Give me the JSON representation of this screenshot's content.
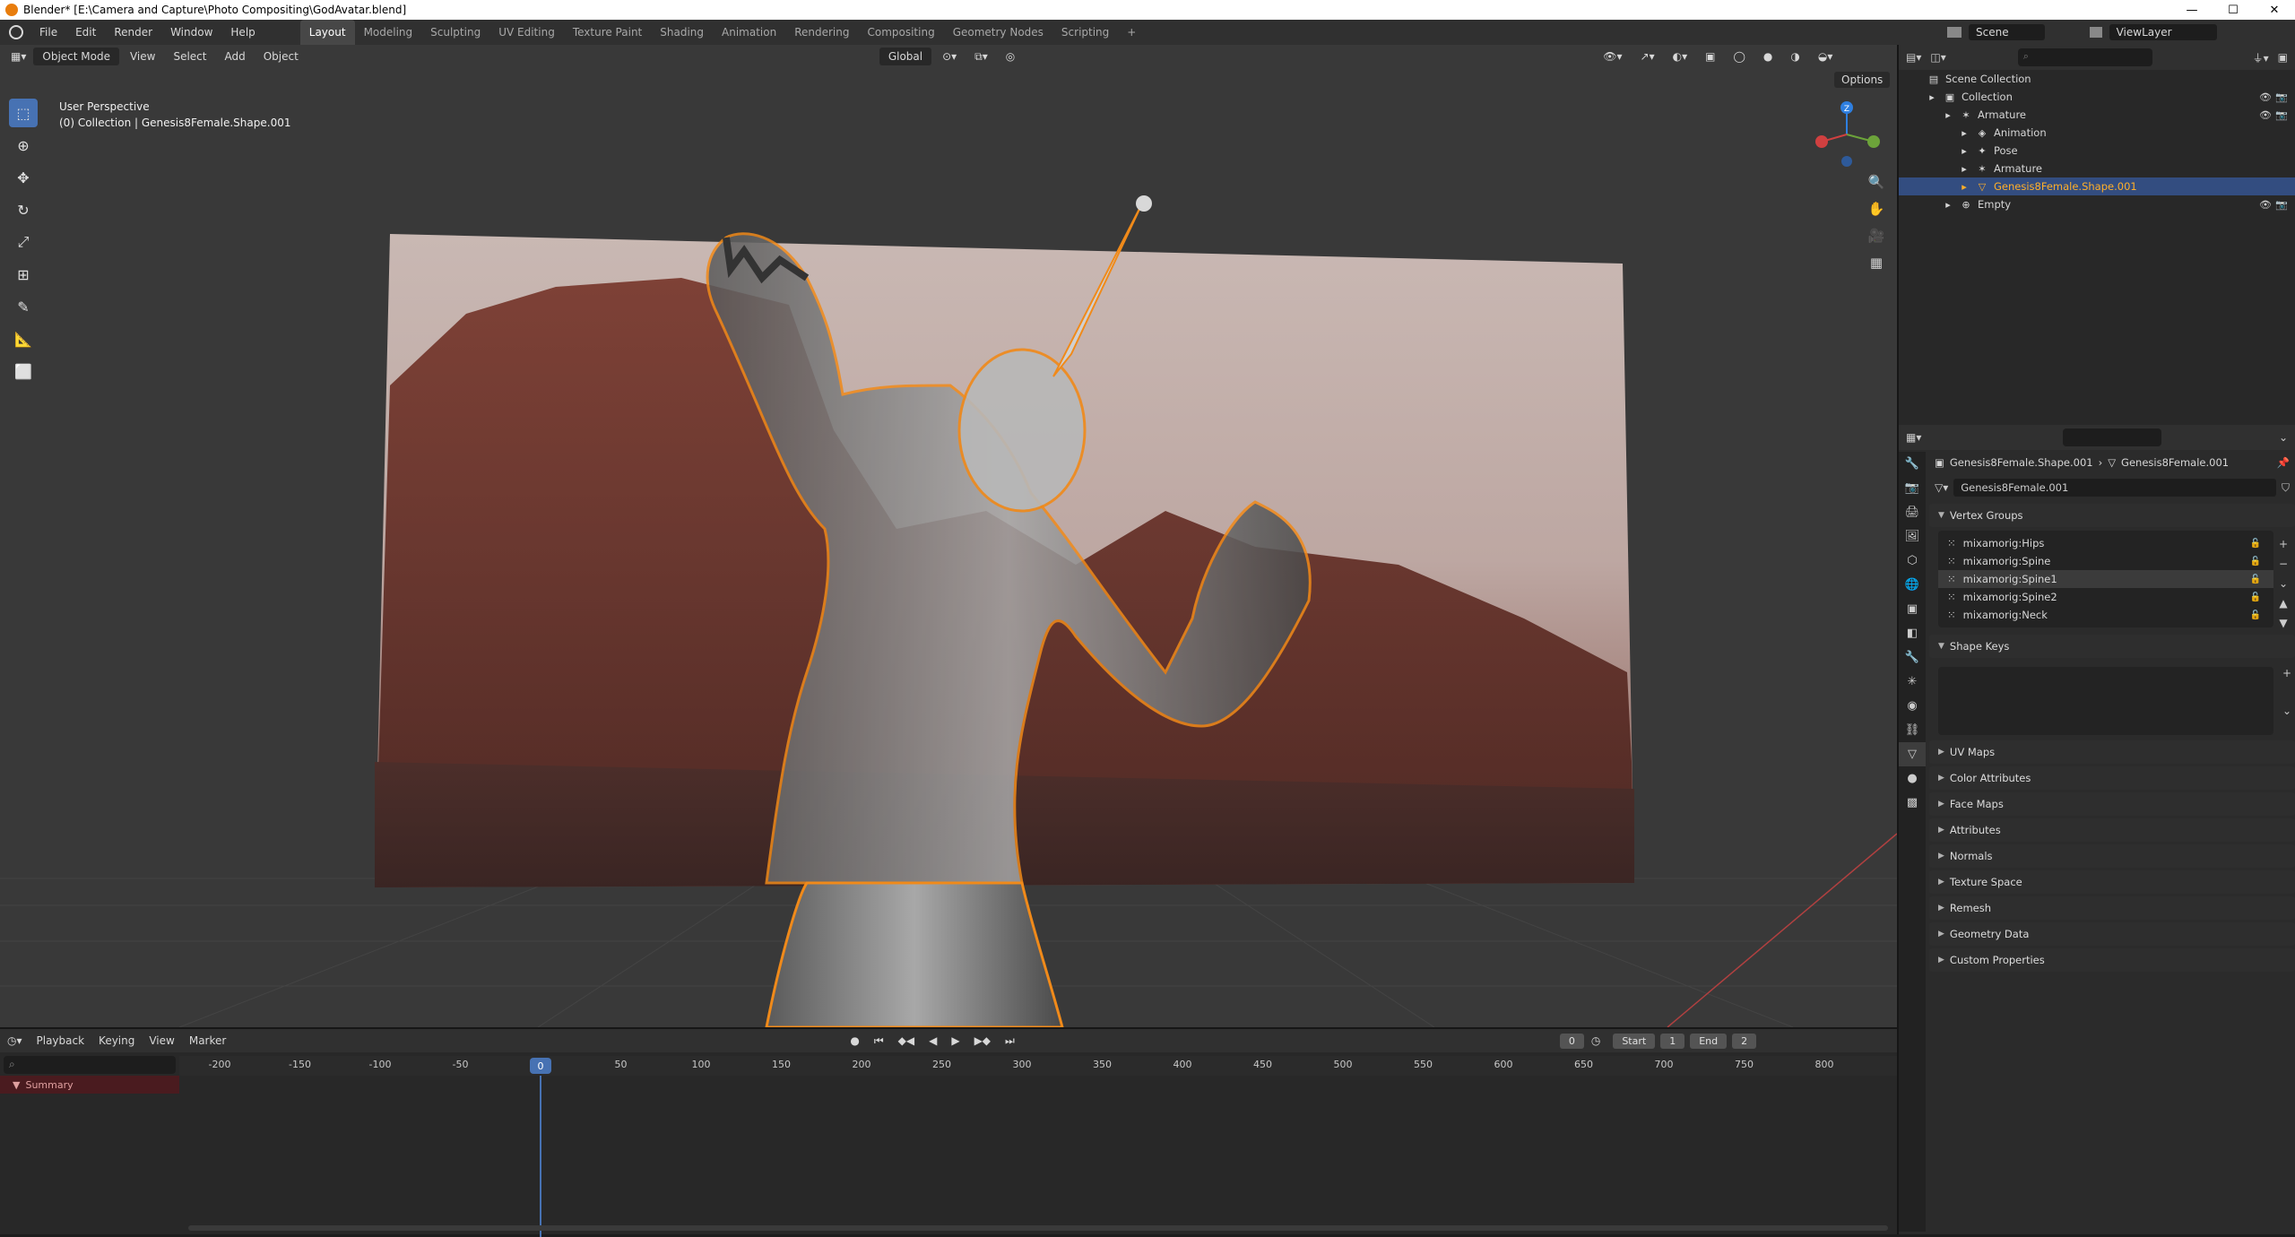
{
  "window": {
    "title": "Blender* [E:\\Camera and Capture\\Photo Compositing\\GodAvatar.blend]",
    "min": "—",
    "max": "☐",
    "close": "✕"
  },
  "menu": [
    "File",
    "Edit",
    "Render",
    "Window",
    "Help"
  ],
  "workspaces": [
    "Layout",
    "Modeling",
    "Sculpting",
    "UV Editing",
    "Texture Paint",
    "Shading",
    "Animation",
    "Rendering",
    "Compositing",
    "Geometry Nodes",
    "Scripting",
    "+"
  ],
  "active_workspace": "Layout",
  "scene": {
    "label": "Scene",
    "viewlayer": "ViewLayer"
  },
  "viewport": {
    "mode": "Object Mode",
    "menus": [
      "View",
      "Select",
      "Add",
      "Object"
    ],
    "transform": "Global",
    "options": "Options",
    "overlay_line1": "User Perspective",
    "overlay_line2": "(0) Collection | Genesis8Female.Shape.001",
    "gizmo": {
      "x": "X",
      "y": "Y",
      "z": "Z"
    }
  },
  "outliner": {
    "search_placeholder": "",
    "rows": [
      {
        "label": "Scene Collection",
        "indent": 0,
        "icon": "▤"
      },
      {
        "label": "Collection",
        "indent": 1,
        "icon": "▣"
      },
      {
        "label": "Armature",
        "indent": 2,
        "icon": "✶"
      },
      {
        "label": "Animation",
        "indent": 3,
        "icon": "◈"
      },
      {
        "label": "Pose",
        "indent": 3,
        "icon": "✦"
      },
      {
        "label": "Armature",
        "indent": 3,
        "icon": "✶"
      },
      {
        "label": "Genesis8Female.Shape.001",
        "indent": 3,
        "icon": "▽"
      },
      {
        "label": "Empty",
        "indent": 2,
        "icon": "⊕"
      }
    ]
  },
  "properties": {
    "breadcrumb_obj": "Genesis8Female.Shape.001",
    "breadcrumb_mesh": "Genesis8Female.001",
    "mesh_name": "Genesis8Female.001",
    "vertex_groups_title": "Vertex Groups",
    "vertex_groups": [
      "mixamorig:Hips",
      "mixamorig:Spine",
      "mixamorig:Spine1",
      "mixamorig:Spine2",
      "mixamorig:Neck"
    ],
    "selected_group": "mixamorig:Spine1",
    "shape_keys_title": "Shape Keys",
    "panels": [
      "UV Maps",
      "Color Attributes",
      "Face Maps",
      "Attributes",
      "Normals",
      "Texture Space",
      "Remesh",
      "Geometry Data",
      "Custom Properties"
    ]
  },
  "timeline": {
    "menus": [
      "Playback",
      "Keying",
      "View",
      "Marker"
    ],
    "current_frame": "0",
    "start_label": "Start",
    "start": "1",
    "end_label": "End",
    "end": "2",
    "summary": "Summary",
    "ticks": [
      "-200",
      "-150",
      "-100",
      "-50",
      "0",
      "50",
      "100",
      "150",
      "200",
      "250",
      "300",
      "350",
      "400",
      "450",
      "500",
      "550",
      "600",
      "650",
      "700",
      "750",
      "800"
    ],
    "playhead": "0"
  }
}
